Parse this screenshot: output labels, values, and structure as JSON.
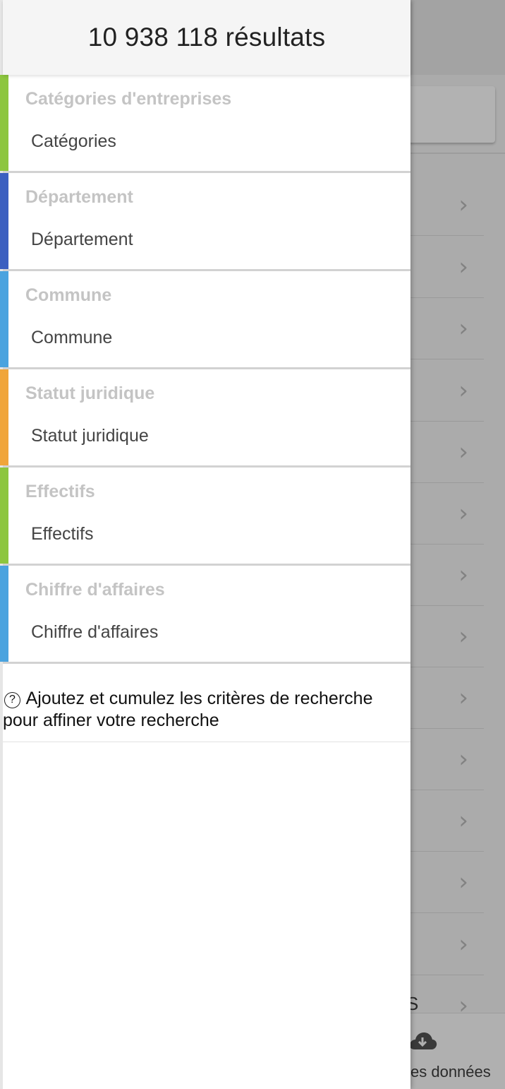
{
  "drawer": {
    "results_title": "10 938 118 résultats",
    "filters": [
      {
        "title": "Catégories d'entreprises",
        "value": "Catégories",
        "color": "#8dc63f"
      },
      {
        "title": "Département",
        "value": "Département",
        "color": "#3b5fc0"
      },
      {
        "title": "Commune",
        "value": "Commune",
        "color": "#4aa3df"
      },
      {
        "title": "Statut juridique",
        "value": "Statut juridique",
        "color": "#f0a53a"
      },
      {
        "title": "Effectifs",
        "value": "Effectifs",
        "color": "#8dc63f"
      },
      {
        "title": "Chiffre d'affaires",
        "value": "Chiffre d'affaires",
        "color": "#4aa3df"
      }
    ],
    "hint": {
      "icon": "help-circle-icon",
      "text": "Ajoutez et cumulez les critères de recherche pour affiner votre recherche"
    }
  },
  "background": {
    "chevron_icon": "chevron-right-icon",
    "partial_text": "S",
    "footer": {
      "icon": "cloud-download-icon",
      "label": "es données"
    }
  }
}
